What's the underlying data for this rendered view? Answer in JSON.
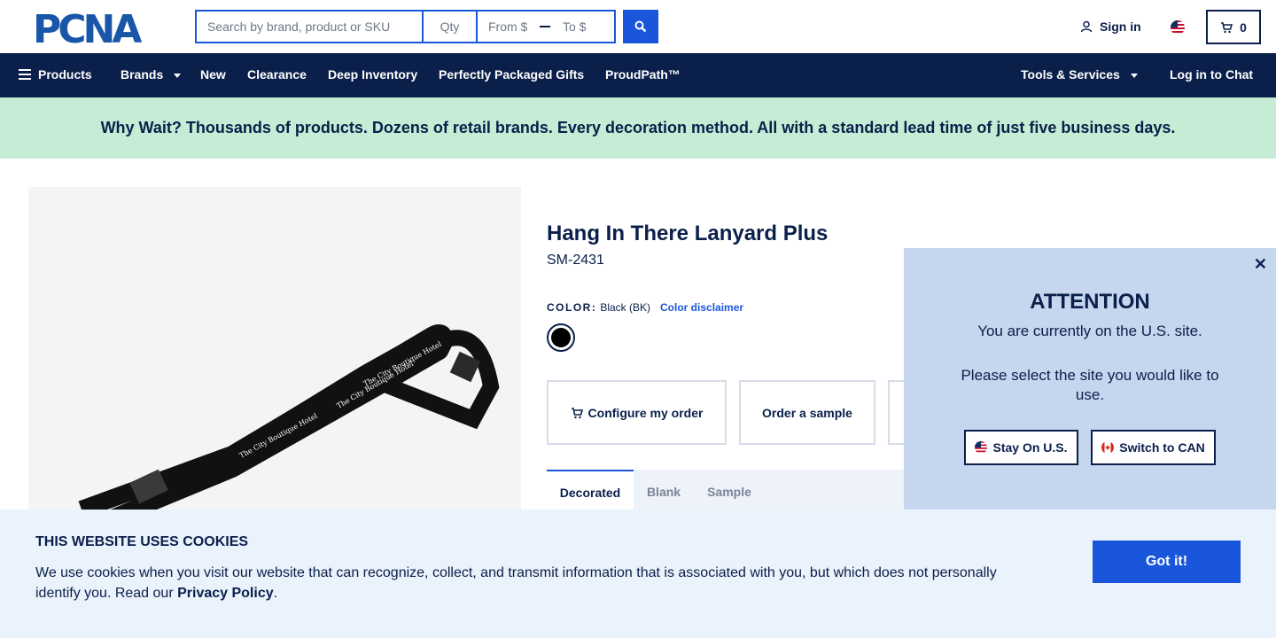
{
  "header": {
    "logo_text": "PCNA",
    "search_placeholder": "Search by brand, product or SKU",
    "qty_placeholder": "Qty",
    "from_placeholder": "From $",
    "to_placeholder": "To $",
    "signin_label": "Sign in",
    "cart_count": "0"
  },
  "nav": {
    "products": "Products",
    "brands": "Brands",
    "new": "New",
    "clearance": "Clearance",
    "deep_inventory": "Deep Inventory",
    "gifts": "Perfectly Packaged Gifts",
    "proudpath": "ProudPath™",
    "tools": "Tools & Services",
    "chat": "Log in to Chat"
  },
  "banner": {
    "text": "Why Wait? Thousands of products. Dozens of retail brands. Every decoration method. All with a standard lead time of just five business days."
  },
  "product": {
    "title": "Hang In There Lanyard Plus",
    "sku": "SM-2431",
    "color_label": "COLOR:",
    "color_value": "Black (BK)",
    "color_disclaimer": "Color disclaimer",
    "lanyard_print": "The City Boutique Hotel",
    "configure_label": "Configure my order",
    "sample_label": "Order a sample",
    "tabs": [
      "Decorated",
      "Blank",
      "Sample"
    ]
  },
  "attention": {
    "title": "ATTENTION",
    "message1": "You are currently on the U.S. site.",
    "message2": "Please select the site you would like to use.",
    "stay_label": "Stay On U.S.",
    "switch_label": "Switch to CAN"
  },
  "cookie": {
    "title": "THIS WEBSITE USES COOKIES",
    "text": "We use cookies when you visit our website that can recognize, collect, and transmit information that is associated with you, but which does not personally identify you. Read our ",
    "link": "Privacy Policy",
    "end": ".",
    "button": "Got it!"
  },
  "colors": {
    "navy": "#0a1f4a",
    "blue": "#1a56db",
    "banner_green": "#c5ecd4",
    "popup_blue": "#c6d6ef",
    "cookie_bg": "#eaf2fb"
  }
}
